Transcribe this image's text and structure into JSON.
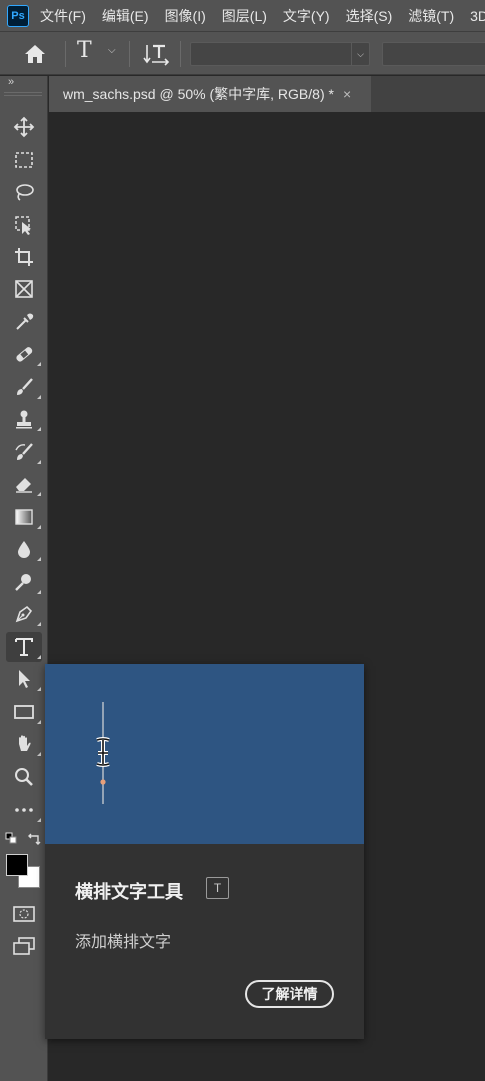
{
  "app": {
    "logo_text": "Ps"
  },
  "menu": [
    {
      "label": "文件(F)"
    },
    {
      "label": "编辑(E)"
    },
    {
      "label": "图像(I)"
    },
    {
      "label": "图层(L)"
    },
    {
      "label": "文字(Y)"
    },
    {
      "label": "选择(S)"
    },
    {
      "label": "滤镜(T)"
    },
    {
      "label": "3D"
    }
  ],
  "options_bar": {
    "home_icon": "home-icon",
    "type_tool_glyph": "T",
    "font_family_value": "",
    "font_style_value": ""
  },
  "toolbar": {
    "collapse_label": "»",
    "tools": [
      {
        "name": "move-tool",
        "icon": "move-icon"
      },
      {
        "name": "marquee-tool",
        "icon": "rect-marquee-icon"
      },
      {
        "name": "lasso-tool",
        "icon": "lasso-icon"
      },
      {
        "name": "object-select-tool",
        "icon": "object-select-icon"
      },
      {
        "name": "crop-tool",
        "icon": "crop-icon"
      },
      {
        "name": "frame-tool",
        "icon": "frame-icon"
      },
      {
        "name": "eyedropper-tool",
        "icon": "eyedropper-icon"
      },
      {
        "name": "healing-brush-tool",
        "icon": "bandage-icon"
      },
      {
        "name": "brush-tool",
        "icon": "brush-icon"
      },
      {
        "name": "clone-stamp-tool",
        "icon": "stamp-icon"
      },
      {
        "name": "history-brush-tool",
        "icon": "history-brush-icon"
      },
      {
        "name": "eraser-tool",
        "icon": "eraser-icon"
      },
      {
        "name": "gradient-tool",
        "icon": "gradient-icon"
      },
      {
        "name": "blur-tool",
        "icon": "drop-icon"
      },
      {
        "name": "dodge-tool",
        "icon": "dodge-icon"
      },
      {
        "name": "pen-tool",
        "icon": "pen-icon"
      },
      {
        "name": "type-tool",
        "icon": "type-icon",
        "selected": true
      },
      {
        "name": "path-select-tool",
        "icon": "arrow-icon"
      },
      {
        "name": "rectangle-tool",
        "icon": "rectangle-icon"
      },
      {
        "name": "hand-tool",
        "icon": "hand-icon"
      },
      {
        "name": "zoom-tool",
        "icon": "zoom-icon"
      },
      {
        "name": "edit-toolbar",
        "icon": "more-icon"
      }
    ],
    "foreground_color": "#000000",
    "background_color": "#ffffff"
  },
  "document_tab": {
    "title": "wm_sachs.psd @ 50% (繁中字库, RGB/8) *",
    "close_glyph": "×"
  },
  "tooltip": {
    "title": "横排文字工具",
    "shortcut": "T",
    "description": "添加横排文字",
    "learn_more_label": "了解详情",
    "preview_color": "#2e5582"
  }
}
